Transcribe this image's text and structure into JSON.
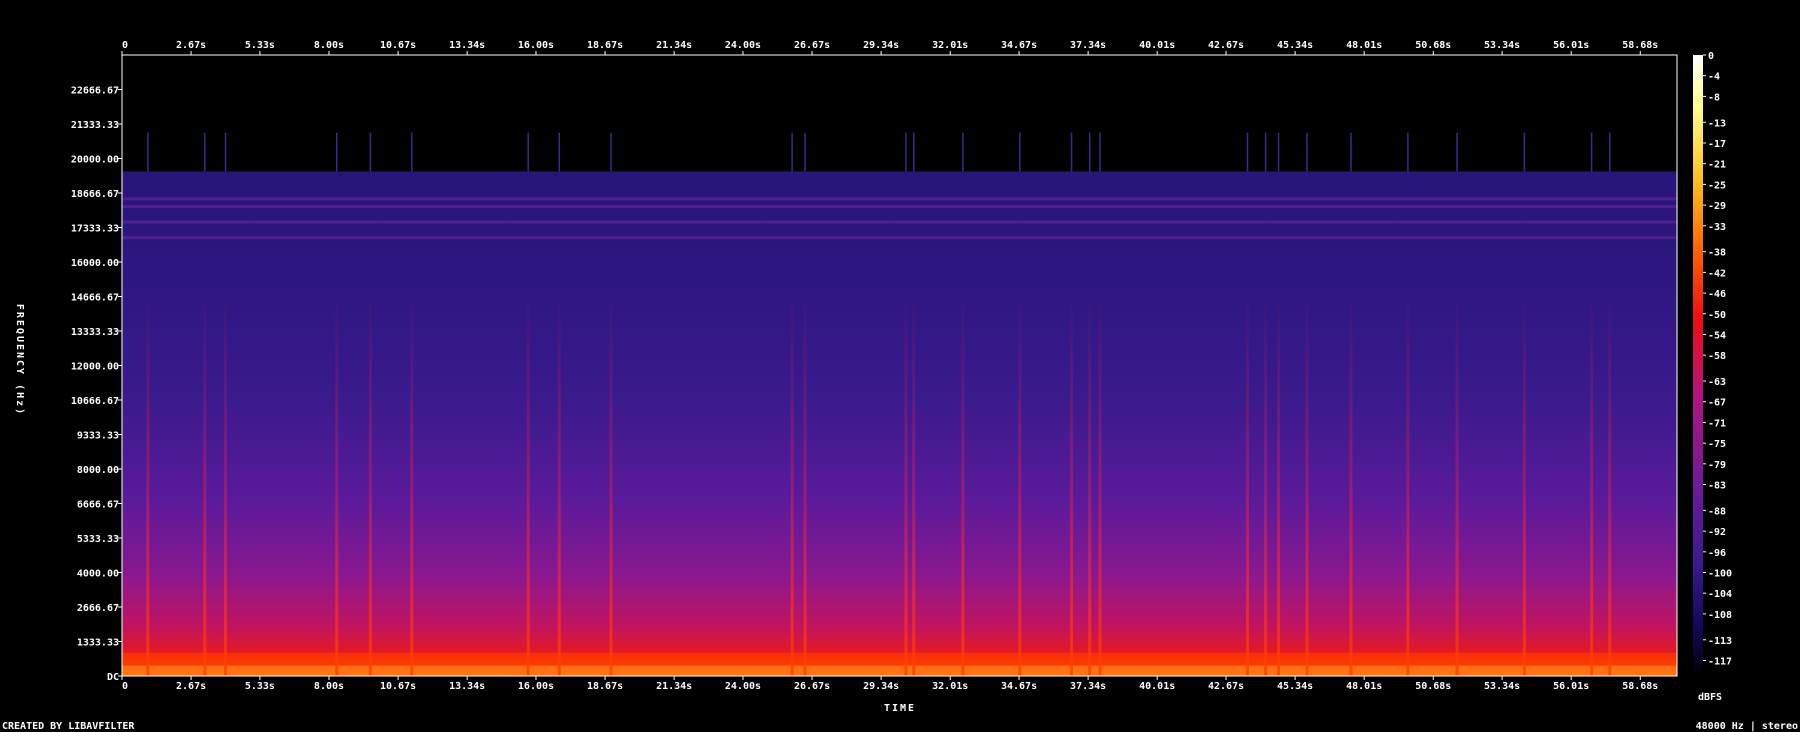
{
  "chart_data": {
    "type": "heatmap",
    "title": "",
    "xlabel": "TIME",
    "ylabel": "FREQUENCY (Hz)",
    "x_ticks": [
      "0",
      "2.67s",
      "5.33s",
      "8.00s",
      "10.67s",
      "13.34s",
      "16.00s",
      "18.67s",
      "21.34s",
      "24.00s",
      "26.67s",
      "29.34s",
      "32.01s",
      "34.67s",
      "37.34s",
      "40.01s",
      "42.67s",
      "45.34s",
      "48.01s",
      "50.68s",
      "53.34s",
      "56.01s",
      "58.68s"
    ],
    "x_tick_values": [
      0,
      2.67,
      5.33,
      8.0,
      10.67,
      13.34,
      16.0,
      18.67,
      21.34,
      24.0,
      26.67,
      29.34,
      32.01,
      34.67,
      37.34,
      40.01,
      42.67,
      45.34,
      48.01,
      50.68,
      53.34,
      56.01,
      58.68
    ],
    "xlim": [
      0,
      60.1
    ],
    "y_ticks": [
      "DC",
      "1333.33",
      "2666.67",
      "4000.00",
      "5333.33",
      "6666.67",
      "8000.00",
      "9333.33",
      "10666.67",
      "12000.00",
      "13333.33",
      "14666.67",
      "16000.00",
      "17333.33",
      "18666.67",
      "20000.00",
      "21333.33",
      "22666.67"
    ],
    "y_tick_values": [
      0,
      1333.33,
      2666.67,
      4000.0,
      5333.33,
      6666.67,
      8000.0,
      9333.33,
      10666.67,
      12000.0,
      13333.33,
      14666.67,
      16000.0,
      17333.33,
      18666.67,
      20000.0,
      21333.33,
      22666.67
    ],
    "ylim": [
      0,
      24000
    ],
    "content_cutoff_hz": 19500,
    "colorbar": {
      "label": "dBFS",
      "ticks": [
        "0",
        "-4",
        "-8",
        "-13",
        "-17",
        "-21",
        "-25",
        "-29",
        "-33",
        "-38",
        "-42",
        "-46",
        "-50",
        "-54",
        "-58",
        "-63",
        "-67",
        "-71",
        "-75",
        "-79",
        "-83",
        "-88",
        "-92",
        "-96",
        "-100",
        "-104",
        "-108",
        "-113",
        "-117"
      ],
      "tick_values": [
        0,
        -4,
        -8,
        -13,
        -17,
        -21,
        -25,
        -29,
        -33,
        -38,
        -42,
        -46,
        -50,
        -54,
        -58,
        -63,
        -67,
        -71,
        -75,
        -79,
        -83,
        -88,
        -92,
        -96,
        -100,
        -104,
        -108,
        -113,
        -117
      ],
      "range": [
        -120,
        0
      ],
      "colors": [
        "#000000",
        "#1a0a5c",
        "#3a1a8c",
        "#6a1a9c",
        "#a0179a",
        "#e0104a",
        "#ff2a00",
        "#ff8a00",
        "#ffd030",
        "#ffffa0",
        "#ffffff"
      ]
    },
    "transients_s": [
      1.0,
      3.2,
      4.0,
      8.3,
      9.6,
      11.2,
      15.7,
      16.9,
      18.9,
      25.9,
      26.4,
      30.3,
      30.6,
      32.5,
      34.7,
      36.7,
      37.4,
      37.8,
      43.5,
      44.2,
      44.7,
      45.8,
      47.5,
      49.7,
      51.6,
      54.2,
      56.8,
      57.5
    ]
  },
  "footer": {
    "left": "CREATED BY LIBAVFILTER",
    "right": "48000 Hz | stereo"
  }
}
